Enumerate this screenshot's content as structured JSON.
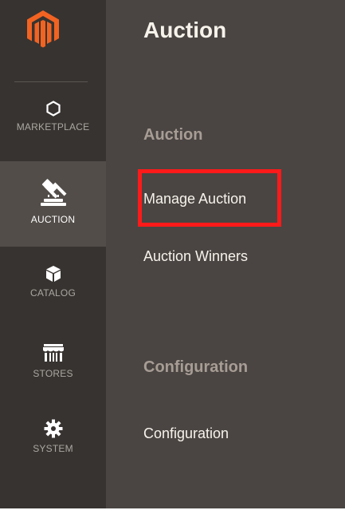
{
  "sidebar": {
    "logo_icon": "magento-logo-icon",
    "brand_color": "#f26322",
    "items": [
      {
        "label": "MARKETPLACE",
        "icon": "hexagon-icon"
      },
      {
        "label": "AUCTION",
        "icon": "gavel-icon",
        "active": true
      },
      {
        "label": "CATALOG",
        "icon": "box-icon"
      },
      {
        "label": "STORES",
        "icon": "storefront-icon"
      },
      {
        "label": "SYSTEM",
        "icon": "gear-icon"
      }
    ]
  },
  "flyout": {
    "title": "Auction",
    "sections": [
      {
        "title": "Auction",
        "links": [
          "Manage Auction",
          "Auction Winners"
        ]
      },
      {
        "title": "Configuration",
        "links": [
          "Configuration"
        ]
      }
    ]
  },
  "annotation": {
    "highlight_color": "#ff1a1a",
    "highlighted_item": "Manage Auction"
  }
}
